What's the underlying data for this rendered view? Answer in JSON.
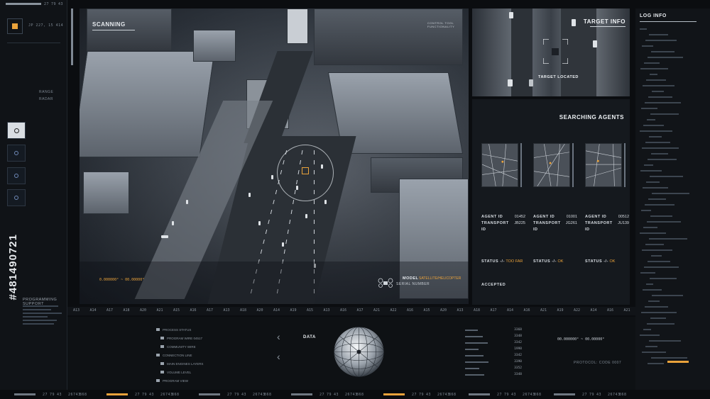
{
  "left_rail": {
    "coords": "JP 227, 15 414",
    "labels": [
      "RANGE",
      "RADAR"
    ],
    "section_title": "PROGRAMMING SUPPORT",
    "watermark_number": "#481490721",
    "top_numbers": [
      "27",
      "79",
      "43"
    ]
  },
  "scan": {
    "title": "SCANNING",
    "model_label": "MODEL",
    "model_value": "SATELLITE/HELICOPTER",
    "serial_label": "SERIAL NUMBER",
    "coord_readout": "0.000000° ~ 00.00000°",
    "top_caption": "CONTROL TOOL FUNCTIONALITY"
  },
  "target": {
    "title": "TARGET INFO",
    "status_text": "TARGET LOCATED"
  },
  "agents": {
    "title": "SEARCHING AGENTS",
    "list": [
      {
        "agent_label": "AGENT ID",
        "agent_id": "01452",
        "transport_label": "TRANSPORT ID",
        "transport_id": "JB225",
        "status_label": "STATUS -/-",
        "status": "TOO FAR"
      },
      {
        "agent_label": "AGENT ID",
        "agent_id": "01001",
        "transport_label": "TRANSPORT ID",
        "transport_id": "JG261",
        "status_label": "STATUS -/-",
        "status": "OK"
      },
      {
        "agent_label": "AGENT ID",
        "agent_id": "00512",
        "transport_label": "TRANSPORT ID",
        "transport_id": "JU139",
        "status_label": "STATUS -/-",
        "status": "OK"
      }
    ],
    "accepted": "ACCEPTED"
  },
  "log": {
    "title": "LOG INFO"
  },
  "axis_ticks": [
    "A13",
    "A14",
    "A17",
    "A18",
    "A20",
    "A21",
    "A15",
    "A16",
    "A17",
    "A13",
    "A18",
    "A20",
    "A14",
    "A19",
    "A15",
    "A13",
    "A16",
    "A17",
    "A21",
    "A22",
    "A16",
    "A15",
    "A20",
    "A13",
    "A18",
    "A17",
    "A14",
    "A16",
    "A21",
    "A19",
    "A22",
    "A14",
    "A16",
    "A21"
  ],
  "bottom": {
    "data_label": "DATA",
    "coord_readout": "00.000000° ~ 00.00000°",
    "protocol": "PROTOCOL: CODE 0007",
    "tree_items": [
      "PROCESS STATUS",
      "PROGRAM WIRE 04517",
      "COMMUNITY WIRE",
      "CONNECTION LINE",
      "MAIN ENGINES LAYERS",
      "VOLUME LEVEL",
      "PROGRAM VIEW"
    ],
    "readouts": [
      "3368",
      "3348",
      "3342",
      "1998",
      "3342",
      "3390",
      "3352",
      "3348"
    ]
  },
  "footer": {
    "numbers": [
      "27",
      "79",
      "43",
      "26743",
      "868"
    ]
  },
  "colors": {
    "accent": "#e9a23b",
    "panel": "#111418",
    "background": "#0b0d10"
  }
}
